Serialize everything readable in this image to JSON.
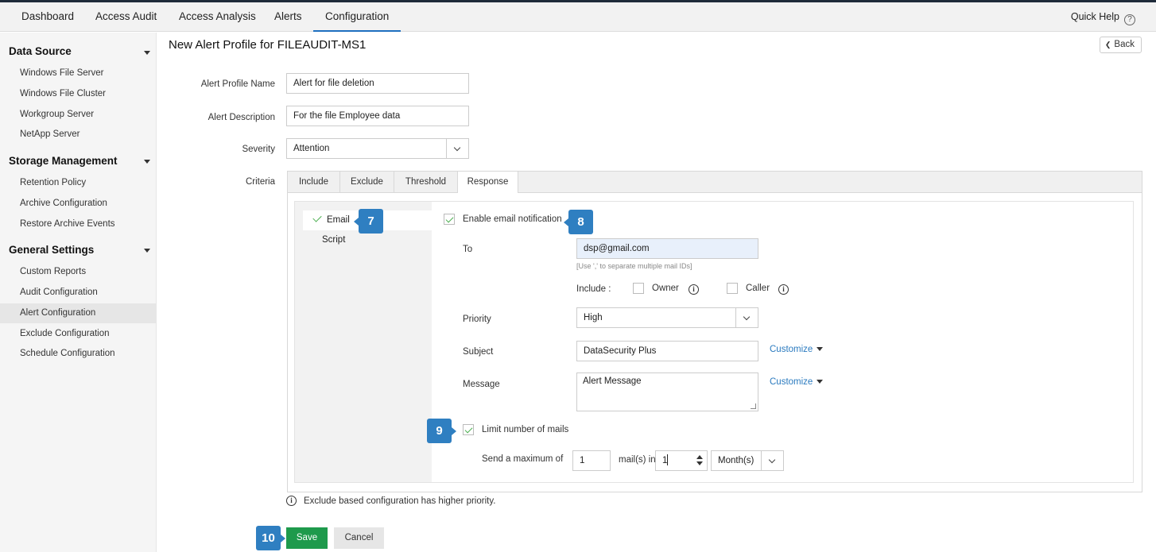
{
  "nav": {
    "tabs": [
      "Dashboard",
      "Access Audit",
      "Access Analysis",
      "Alerts",
      "Configuration"
    ],
    "active_tab": "Configuration",
    "quick_help": "Quick Help",
    "quick_help_icon": "?"
  },
  "sidebar": {
    "sections": [
      {
        "title": "Data Source",
        "items": [
          "Windows File Server",
          "Windows File Cluster",
          "Workgroup Server",
          "NetApp Server"
        ]
      },
      {
        "title": "Storage Management",
        "items": [
          "Retention Policy",
          "Archive Configuration",
          "Restore Archive Events"
        ]
      },
      {
        "title": "General Settings",
        "items": [
          "Custom Reports",
          "Audit Configuration",
          "Alert Configuration",
          "Exclude Configuration",
          "Schedule Configuration"
        ]
      }
    ],
    "active_item": "Alert Configuration"
  },
  "page": {
    "title": "New Alert Profile for FILEAUDIT-MS1",
    "back_label": "Back"
  },
  "form": {
    "profile_name_label": "Alert Profile Name",
    "profile_name_value": "Alert for file deletion",
    "description_label": "Alert Description",
    "description_value": "For the file Employee data",
    "severity_label": "Severity",
    "severity_value": "Attention",
    "criteria_label": "Criteria"
  },
  "criteria_tabs": [
    "Include",
    "Exclude",
    "Threshold",
    "Response"
  ],
  "active_criteria_tab": "Response",
  "response": {
    "methods": [
      "Email",
      "Script"
    ],
    "active_method": "Email",
    "enable_email_label": "Enable email notification",
    "enable_email_checked": true,
    "to_label": "To",
    "to_value": "dsp@gmail.com",
    "to_hint": "[Use ',' to separate multiple mail IDs]",
    "include_label": "Include :",
    "owner_label": "Owner",
    "caller_label": "Caller",
    "info_glyph": "i",
    "priority_label": "Priority",
    "priority_value": "High",
    "subject_label": "Subject",
    "subject_value": "DataSecurity Plus",
    "message_label": "Message",
    "message_value": "Alert Message",
    "customize_label": "Customize",
    "limit_label": "Limit number of mails",
    "limit_checked": true,
    "send_max_label": "Send a maximum of",
    "max_mails_value": "1",
    "mails_in_label": "mail(s) in",
    "period_value": "1",
    "period_unit": "Month(s)"
  },
  "note": "Exclude based configuration has higher priority.",
  "buttons": {
    "save": "Save",
    "cancel": "Cancel"
  },
  "badges": {
    "b7": "7",
    "b8": "8",
    "b9": "9",
    "b10": "10"
  },
  "colors": {
    "accent": "#2f7fc1",
    "save": "#1e9a4c",
    "link": "#2a7abf",
    "active_tab_underline": "#1e6fc0"
  }
}
